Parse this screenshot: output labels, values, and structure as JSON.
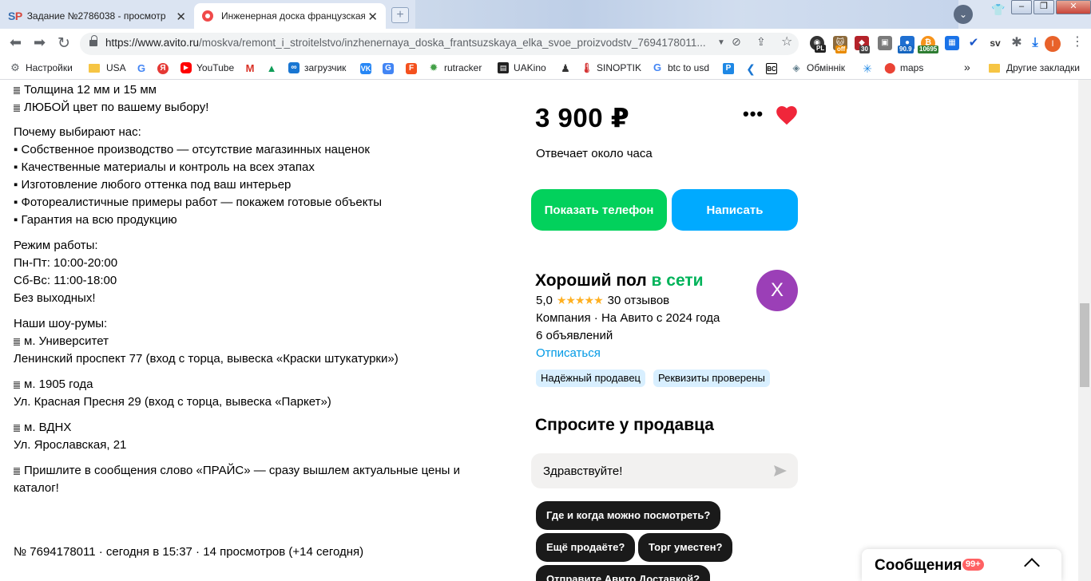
{
  "browser": {
    "tabs": [
      {
        "title": "Задание №2786038 - просмотр з",
        "favicon": "SP"
      },
      {
        "title": "Инженерная доска французская",
        "favicon": "avito-icon"
      }
    ],
    "url_host": "https://www.avito.ru",
    "url_path": "/moskva/remont_i_stroitelstvo/inzhenernaya_doska_frantsuzskaya_elka_svoe_proizvodstv_7694178011...",
    "extension_badges": {
      "off": "off",
      "count30": "30",
      "n909": "90.9",
      "n10695": "10695",
      "pl": "PL"
    },
    "profile_initial": "I"
  },
  "bookmarks": {
    "items": [
      {
        "label": "Настройки"
      },
      {
        "label": "USA"
      },
      {
        "label": "YouTube"
      },
      {
        "label": "загрузчик"
      },
      {
        "label": "rutracker"
      },
      {
        "label": "UAKino"
      },
      {
        "label": "SINOPTIK"
      },
      {
        "label": "btc to usd"
      },
      {
        "label": "Обміннік"
      },
      {
        "label": "maps"
      }
    ],
    "overflow": "»",
    "other_folder": "Другие закладки"
  },
  "description": {
    "lines_top": [
      "Толщина 12 мм и 15 мм",
      "ЛЮБОЙ цвет по вашему выбору!"
    ],
    "why_title": "Почему выбирают нас:",
    "why_items": [
      "▪ Собственное производство — отсутствие магазинных наценок",
      "▪ Качественные материалы и контроль на всех этапах",
      "▪ Изготовление любого оттенка под ваш интерьер",
      "▪ Фотореалистичные примеры работ — покажем готовые объекты",
      "▪ Гарантия на всю продукцию"
    ],
    "schedule_title": "Режим работы:",
    "schedule": [
      "Пн-Пт: 10:00-20:00",
      "Сб-Вс: 11:00-18:00",
      "Без выходных!"
    ],
    "showrooms_title": "Наши шоу-румы:",
    "showroom1_name": "м. Университет",
    "showroom1_addr": "Ленинский проспект 77 (вход с торца, вывеска «Краски штукатурки»)",
    "showroom2_name": "м. 1905 года",
    "showroom2_addr": "Ул. Красная Пресня 29 (вход с торца, вывеска «Паркет»)",
    "showroom3_name": "м. ВДНХ",
    "showroom3_addr": "Ул. Ярославская, 21",
    "price_call_1": "Пришлите в сообщения слово «ПРАЙС» — сразу вышлем актуальные цены и",
    "price_call_2": "каталог!"
  },
  "meta": "№ 7694178011 · сегодня в 15:37 · 14 просмотров (+14 сегодня)",
  "sidebar": {
    "price": "3 900 ₽",
    "reply_time": "Отвечает около часа",
    "show_phone": "Показать телефон",
    "write": "Написать",
    "seller_name": "Хороший пол",
    "online": "в сети",
    "avatar_letter": "X",
    "rating": "5,0",
    "stars": "★★★★★",
    "reviews": "30 отзывов",
    "company": "Компания · На Авито с 2024 года",
    "listings": "6 объявлений",
    "unsubscribe": "Отписаться",
    "badges": [
      "Надёжный продавец",
      "Реквизиты проверены"
    ],
    "ask_title": "Спросите у продавца",
    "message_value": "Здравствуйте!",
    "quick_questions": [
      "Где и когда можно посмотреть?",
      "Ещё продаёте?",
      "Торг уместен?",
      "Отправите Авито Доставкой?"
    ]
  },
  "messages_widget": {
    "label": "Сообщения",
    "badge": "99+"
  },
  "colors": {
    "green": "#02d15c",
    "blue": "#00aaff",
    "heart": "#f0263a",
    "online": "#00b35a",
    "link": "#0099e5",
    "avatar": "#9b3fb7"
  }
}
